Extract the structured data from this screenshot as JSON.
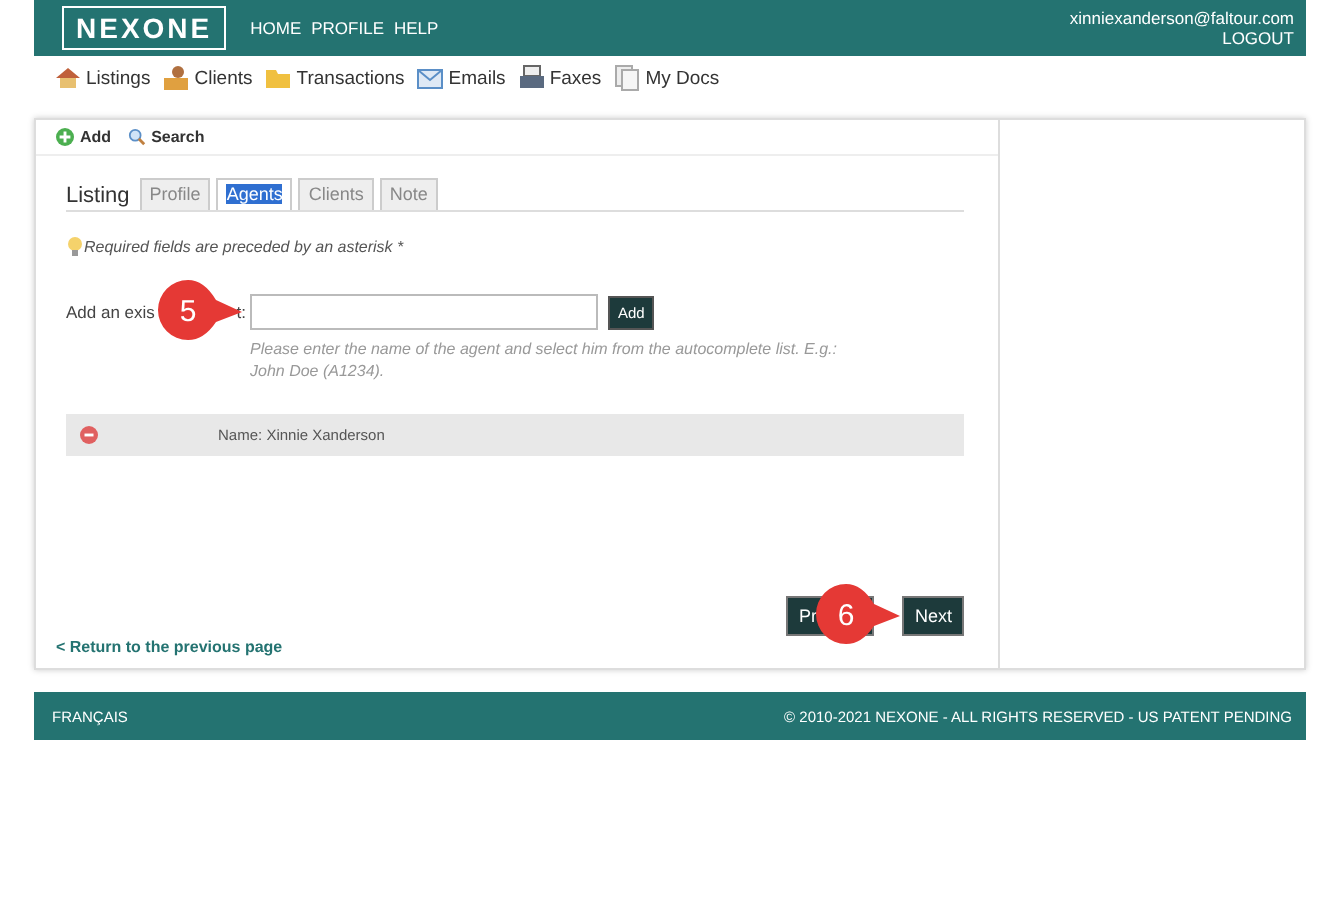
{
  "header": {
    "logo": "NEXONE",
    "nav": [
      "HOME",
      "PROFILE",
      "HELP"
    ],
    "user_email": "xinniexanderson@faltour.com",
    "logout": "LOGOUT"
  },
  "modules": [
    {
      "label": "Listings",
      "kind": "house"
    },
    {
      "label": "Clients",
      "kind": "person"
    },
    {
      "label": "Transactions",
      "kind": "folder"
    },
    {
      "label": "Emails",
      "kind": "mail"
    },
    {
      "label": "Faxes",
      "kind": "printer"
    },
    {
      "label": "My Docs",
      "kind": "docs"
    }
  ],
  "toolbar": [
    {
      "label": "Add",
      "kind": "add"
    },
    {
      "label": "Search",
      "kind": "search"
    }
  ],
  "section_title": "Listing",
  "tabs": [
    {
      "label": "Profile",
      "selected": false
    },
    {
      "label": "Agents",
      "selected": true
    },
    {
      "label": "Clients",
      "selected": false
    },
    {
      "label": "Note",
      "selected": false
    }
  ],
  "required_note": "Required fields are preceded by an asterisk *",
  "agent_field": {
    "label_start": "Add an exis",
    "label_end": "t:",
    "button": "Add",
    "hint": "Please enter the name of the agent and select him from the autocomplete list. E.g.: John Doe (A1234)."
  },
  "agents": [
    {
      "name_label": "Name:",
      "name": "Xinnie Xanderson"
    }
  ],
  "callouts": [
    "5",
    "6"
  ],
  "buttons": {
    "previous": "Pr",
    "next": "Next"
  },
  "return_link": "< Return to the previous page",
  "footer": {
    "language": "FRANÇAIS",
    "copyright": "© 2010-2021 NEXONE - ALL RIGHTS RESERVED - US PATENT PENDING"
  }
}
